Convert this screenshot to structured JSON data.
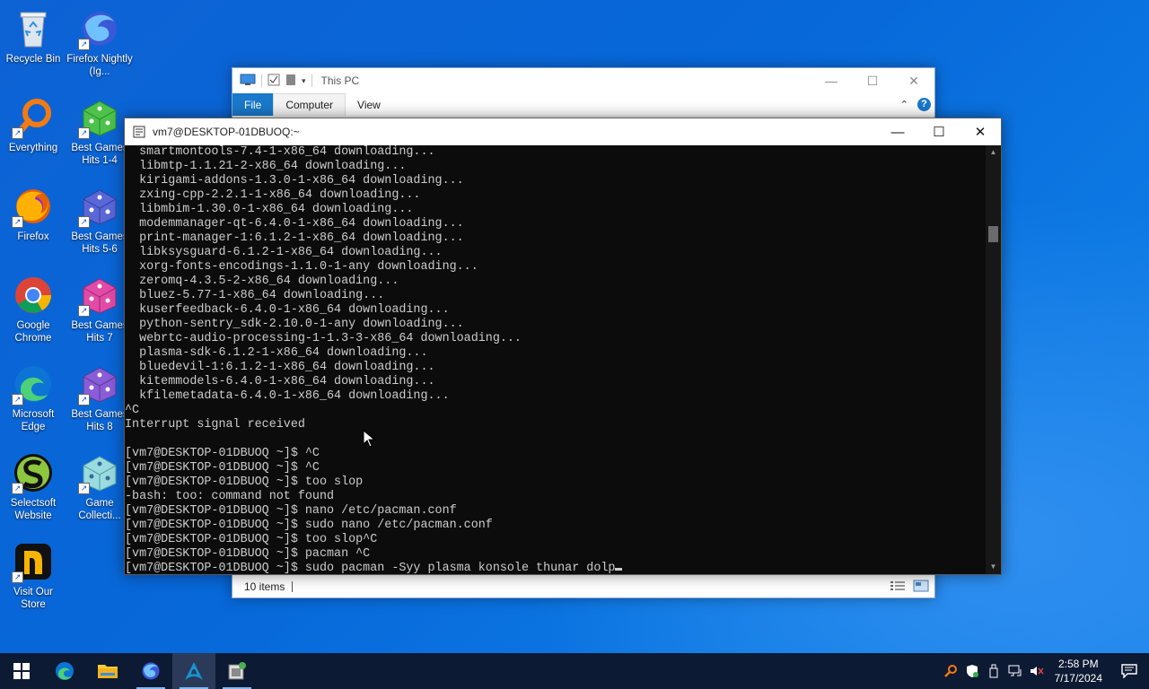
{
  "desktop": {
    "icons": [
      {
        "label": "Recycle Bin",
        "icon": "recycle-bin-icon"
      },
      {
        "label": "Firefox Nightly (Ig...",
        "icon": "firefox-nightly-icon"
      },
      {
        "label": "Everything",
        "icon": "everything-search-icon"
      },
      {
        "label": "Best Games Hits 1-4",
        "icon": "dice-green-icon"
      },
      {
        "label": "Firefox",
        "icon": "firefox-icon"
      },
      {
        "label": "Best Games Hits 5-6",
        "icon": "dice-blue-icon"
      },
      {
        "label": "Google Chrome",
        "icon": "chrome-icon"
      },
      {
        "label": "Best Games Hits 7",
        "icon": "dice-pink-icon"
      },
      {
        "label": "Microsoft Edge",
        "icon": "edge-icon"
      },
      {
        "label": "Best Games Hits 8",
        "icon": "dice-purple-icon"
      },
      {
        "label": "Selectsoft Website",
        "icon": "selectsoft-icon"
      },
      {
        "label": "Game Collecti...",
        "icon": "dice-teal-icon"
      },
      {
        "label": "Visit Our Store",
        "icon": "store-icon"
      }
    ]
  },
  "explorer": {
    "title": "This PC",
    "ribbon_tabs": [
      "File",
      "Computer",
      "View"
    ],
    "status_items": "10 items",
    "colors": {
      "file_tab": "#1979ca"
    }
  },
  "terminal": {
    "title": "vm7@DESKTOP-01DBUOQ:~",
    "lines": [
      "  smartmontools-7.4-1-x86_64 downloading...",
      "  libmtp-1.1.21-2-x86_64 downloading...",
      "  kirigami-addons-1.3.0-1-x86_64 downloading...",
      "  zxing-cpp-2.2.1-1-x86_64 downloading...",
      "  libmbim-1.30.0-1-x86_64 downloading...",
      "  modemmanager-qt-6.4.0-1-x86_64 downloading...",
      "  print-manager-1:6.1.2-1-x86_64 downloading...",
      "  libksysguard-6.1.2-1-x86_64 downloading...",
      "  xorg-fonts-encodings-1.1.0-1-any downloading...",
      "  zeromq-4.3.5-2-x86_64 downloading...",
      "  bluez-5.77-1-x86_64 downloading...",
      "  kuserfeedback-6.4.0-1-x86_64 downloading...",
      "  python-sentry_sdk-2.10.0-1-any downloading...",
      "  webrtc-audio-processing-1-1.3-3-x86_64 downloading...",
      "  plasma-sdk-6.1.2-1-x86_64 downloading...",
      "  bluedevil-1:6.1.2-1-x86_64 downloading...",
      "  kitemmodels-6.4.0-1-x86_64 downloading...",
      "  kfilemetadata-6.4.0-1-x86_64 downloading...",
      "^C",
      "Interrupt signal received",
      "",
      "[vm7@DESKTOP-01DBUOQ ~]$ ^C",
      "[vm7@DESKTOP-01DBUOQ ~]$ ^C",
      "[vm7@DESKTOP-01DBUOQ ~]$ too slop",
      "-bash: too: command not found",
      "[vm7@DESKTOP-01DBUOQ ~]$ nano /etc/pacman.conf",
      "[vm7@DESKTOP-01DBUOQ ~]$ sudo nano /etc/pacman.conf",
      "[vm7@DESKTOP-01DBUOQ ~]$ too slop^C",
      "[vm7@DESKTOP-01DBUOQ ~]$ pacman ^C"
    ],
    "input_line": "[vm7@DESKTOP-01DBUOQ ~]$ sudo pacman -Syy plasma konsole thunar dolp",
    "colors": {
      "background": "#0c0c0c",
      "text": "#cccccc"
    }
  },
  "taskbar": {
    "apps": [
      "start-icon",
      "edge-icon",
      "file-explorer-icon",
      "firefox-nightly-icon",
      "arch-terminal-icon",
      "installer-icon"
    ],
    "clock_time": "2:58 PM",
    "clock_date": "7/17/2024",
    "colors": {
      "background": "#0d1a33"
    }
  }
}
